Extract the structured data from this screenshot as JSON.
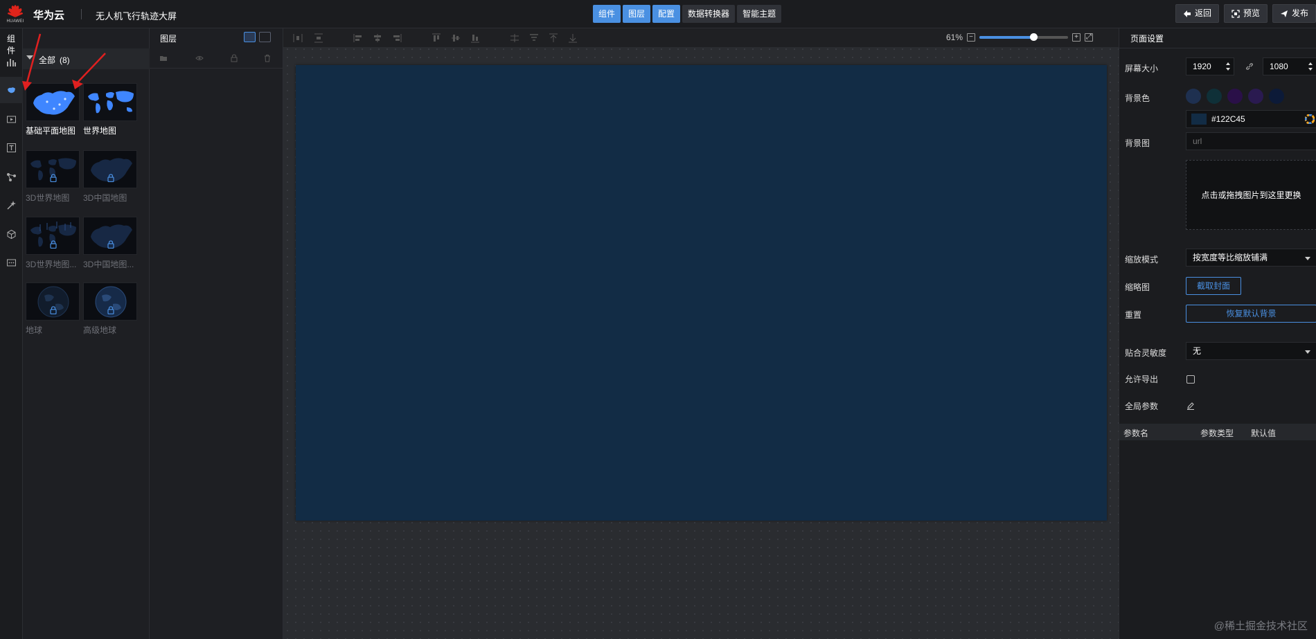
{
  "topbar": {
    "brand": "华为云",
    "logo_text": "HUAWEI",
    "project_title": "无人机飞行轨迹大屏",
    "center_tabs": [
      {
        "label": "组件",
        "active": true
      },
      {
        "label": "图层",
        "active": true
      },
      {
        "label": "配置",
        "active": true
      },
      {
        "label": "数据转换器",
        "active": false
      },
      {
        "label": "智能主题",
        "active": false
      }
    ],
    "buttons": {
      "back": "返回",
      "preview": "预览",
      "publish": "发布"
    }
  },
  "component_panel": {
    "title": "组件",
    "group_label": "全部",
    "group_count": "(8)",
    "items": [
      {
        "label": "基础平面地图",
        "locked": false,
        "icon": "china-map"
      },
      {
        "label": "世界地图",
        "locked": false,
        "icon": "world-map"
      },
      {
        "label": "3D世界地图",
        "locked": true,
        "icon": "world-map"
      },
      {
        "label": "3D中国地图",
        "locked": true,
        "icon": "china-map"
      },
      {
        "label": "3D世界地图...",
        "locked": true,
        "icon": "world-map"
      },
      {
        "label": "3D中国地图...",
        "locked": true,
        "icon": "china-map"
      },
      {
        "label": "地球",
        "locked": true,
        "icon": "globe"
      },
      {
        "label": "高级地球",
        "locked": true,
        "icon": "globe"
      }
    ]
  },
  "layer_panel": {
    "title": "图层"
  },
  "canvas": {
    "zoom_label": "61%",
    "zoom_fraction": 0.61,
    "background_color": "#122C45"
  },
  "settings": {
    "title": "页面设置",
    "screen_size_label": "屏幕大小",
    "width": "1920",
    "height": "1080",
    "bg_color_label": "背景色",
    "swatches": [
      "#1e3050",
      "#0f3038",
      "#2a1048",
      "#2a1a50",
      "#0c1a38"
    ],
    "color_hex": "#122C45",
    "bg_image_label": "背景图",
    "url_placeholder": "url",
    "upload_text": "点击或拖拽图片到这里更换",
    "scale_mode_label": "缩放模式",
    "scale_mode_value": "按宽度等比缩放铺满",
    "thumbnail_label": "缩略图",
    "capture_button": "截取封面",
    "reset_label": "重置",
    "reset_button": "恢复默认背景",
    "snap_label": "贴合灵敏度",
    "snap_value": "无",
    "export_label": "允许导出",
    "export_checked": false,
    "global_params_label": "全局参数",
    "param_columns": [
      "参数名",
      "参数类型",
      "默认值"
    ]
  },
  "watermark": "@稀土掘金技术社区",
  "colors": {
    "accent": "#4a90e2",
    "annotation_arrow": "#e02020"
  }
}
